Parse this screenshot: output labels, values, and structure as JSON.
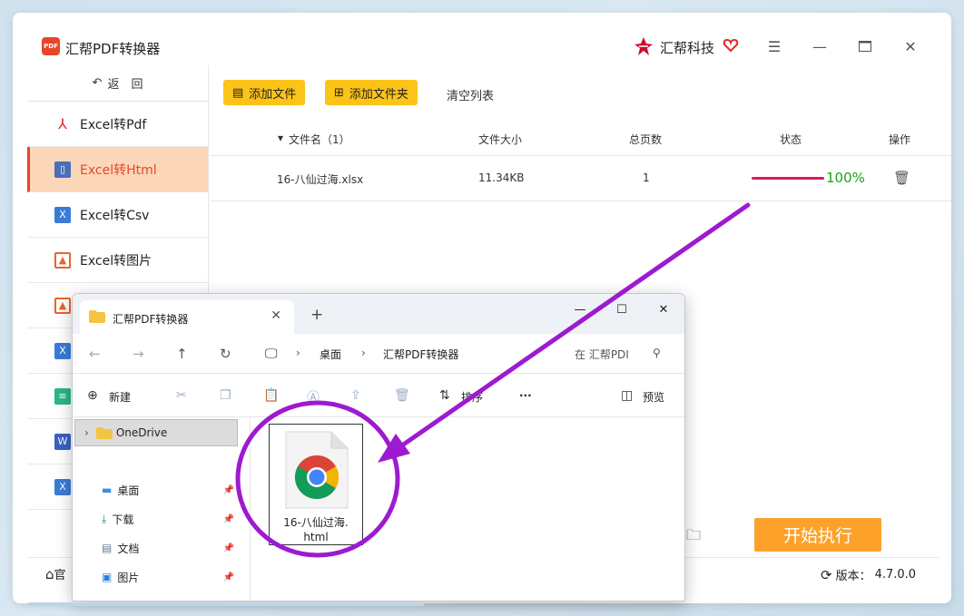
{
  "app": {
    "title": "汇帮PDF转换器",
    "logo_text": "PDF",
    "brand": "汇帮科技",
    "accent": "#e8462b",
    "highlight": "#fcd6b8",
    "button_yellow": "#fcc319",
    "start_orange": "#fca22b"
  },
  "sidebar": {
    "back_label": "返　回",
    "items": [
      {
        "label": "Excel转Pdf",
        "icon": "pdf-icon",
        "active": false
      },
      {
        "label": "Excel转Html",
        "icon": "html-doc-icon",
        "active": true
      },
      {
        "label": "Excel转Csv",
        "icon": "excel-icon",
        "active": false
      },
      {
        "label": "Excel转图片",
        "icon": "image-icon",
        "active": false
      }
    ]
  },
  "toolbar": {
    "add_file": "添加文件",
    "add_folder": "添加文件夹",
    "clear_list": "清空列表"
  },
  "table": {
    "headers": {
      "name": "文件名（1）",
      "size": "文件大小",
      "pages": "总页数",
      "status": "状态",
      "action": "操作"
    },
    "rows": [
      {
        "name": "16-八仙过海.xlsx",
        "size": "11.34KB",
        "pages": "1",
        "status": "100%",
        "progress": 1.0
      }
    ]
  },
  "footer": {
    "start_label": "开始执行",
    "version_label": "版本：",
    "version": "4.7.0.0",
    "home_partial": "官"
  },
  "explorer": {
    "tab_title": "汇帮PDF转换器",
    "address": [
      "桌面",
      "汇帮PDF转换器"
    ],
    "search_placeholder": "在 汇帮PDI",
    "new_label": "新建",
    "sort_label": "排序",
    "preview_label": "预览",
    "tree": {
      "onedrive": "OneDrive",
      "quick_access": [
        {
          "label": "桌面",
          "icon": "desktop-icon"
        },
        {
          "label": "下载",
          "icon": "download-icon"
        },
        {
          "label": "文档",
          "icon": "document-icon"
        },
        {
          "label": "图片",
          "icon": "pictures-icon"
        }
      ]
    },
    "file": {
      "name_line1": "16-八仙过海.",
      "name_line2": "html",
      "icon": "chrome-icon"
    }
  },
  "annotation": {
    "color": "#9d1ad1"
  }
}
